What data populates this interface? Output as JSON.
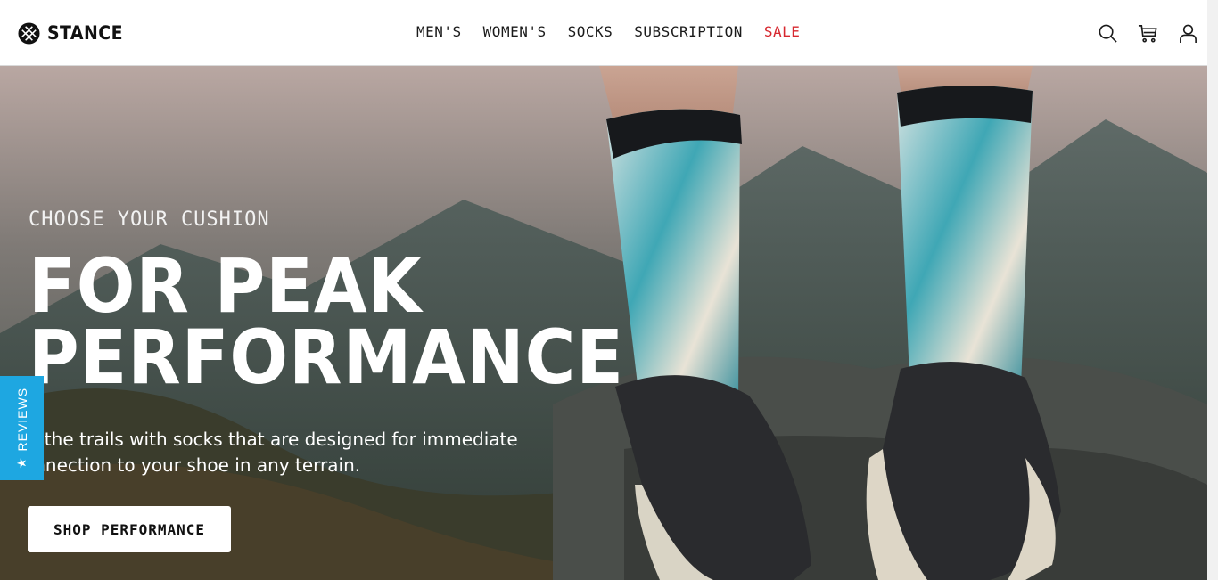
{
  "brand": {
    "name": "STANCE"
  },
  "nav": {
    "items": [
      {
        "label": "MEN'S"
      },
      {
        "label": "WOMEN'S"
      },
      {
        "label": "SOCKS"
      },
      {
        "label": "SUBSCRIPTION"
      },
      {
        "label": "SALE",
        "color": "#d7282f"
      }
    ]
  },
  "actions": [
    "search-icon",
    "cart-icon",
    "account-icon"
  ],
  "hero": {
    "eyebrow": "CHOOSE YOUR CUSHION",
    "headline_line1": "FOR PEAK",
    "headline_line2": "PERFORMANCE",
    "subtext": "Hit the trails with socks that are designed for immediate connection to your shoe in any terrain.",
    "cta_label": "SHOP PERFORMANCE"
  },
  "reviews_tab": {
    "label": "REVIEWS",
    "icon": "star-icon",
    "color": "#1ea7e1"
  }
}
